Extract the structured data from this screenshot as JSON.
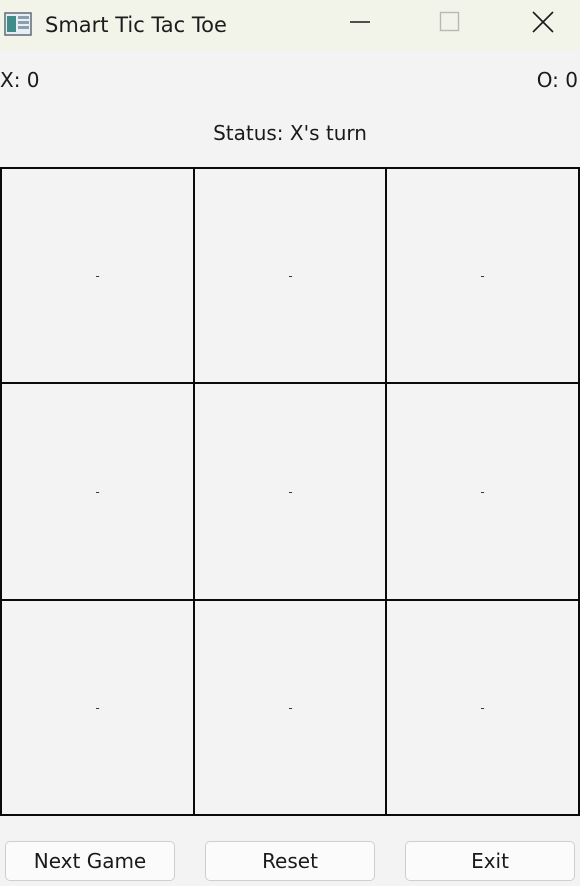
{
  "window": {
    "title": "Smart Tic Tac Toe"
  },
  "scores": {
    "x_label": "X: 0",
    "o_label": "O: 0",
    "x": 0,
    "o": 0
  },
  "status": {
    "text": "Status: X's turn"
  },
  "board": {
    "cells": [
      "-",
      "-",
      "-",
      "-",
      "-",
      "-",
      "-",
      "-",
      "-"
    ]
  },
  "buttons": {
    "next_game": "Next Game",
    "reset": "Reset",
    "exit": "Exit"
  },
  "icons": {
    "app": "tic-tac-toe-app-icon",
    "minimize": "minimize-icon",
    "maximize": "maximize-icon",
    "close": "close-icon"
  },
  "colors": {
    "titlebar": "#f2f4ea",
    "background": "#f3f3f3",
    "grid": "#0a0a0a"
  }
}
